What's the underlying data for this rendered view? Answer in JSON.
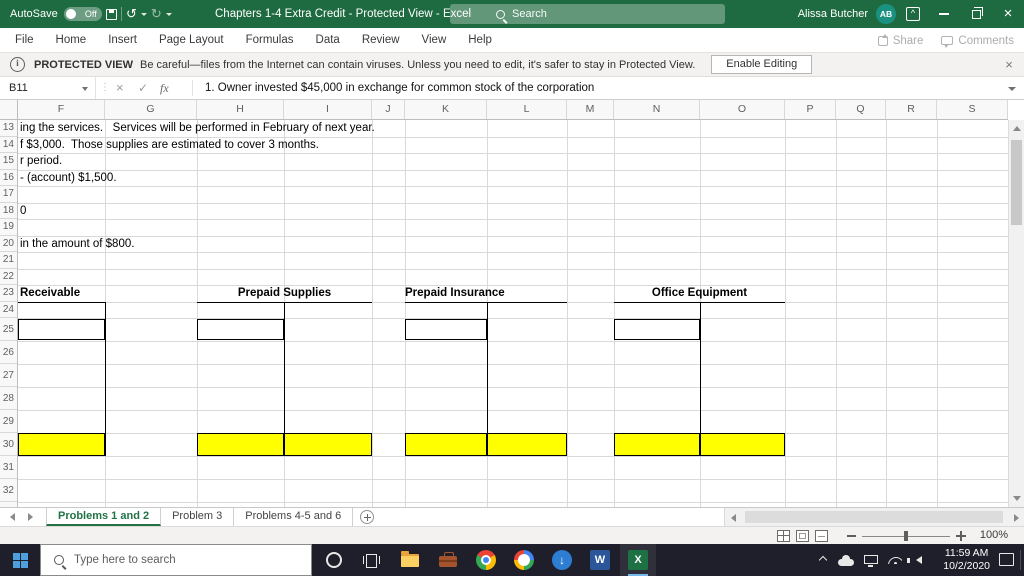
{
  "title_bar": {
    "autosave_label": "AutoSave",
    "autosave_state": "Off",
    "document_title": "Chapters 1-4 Extra Credit - Protected View - Excel",
    "search_placeholder": "Search",
    "user_name": "Alissa Butcher",
    "user_initials": "AB"
  },
  "menu_bar": {
    "tabs": [
      "File",
      "Home",
      "Insert",
      "Page Layout",
      "Formulas",
      "Data",
      "Review",
      "View",
      "Help"
    ],
    "share_label": "Share",
    "comments_label": "Comments"
  },
  "protected_view": {
    "badge": "PROTECTED VIEW",
    "message": "Be careful—files from the Internet can contain viruses. Unless you need to edit, it's safer to stay in Protected View.",
    "enable_button_label": "Enable Editing"
  },
  "formula_bar": {
    "cell_reference": "B11",
    "function_label": "fx",
    "formula_text": "1. Owner invested $45,000 in exchange for common stock of the corporation"
  },
  "grid": {
    "visible_columns": [
      "F",
      "G",
      "H",
      "I",
      "J",
      "K",
      "L",
      "M",
      "N",
      "O",
      "P",
      "Q",
      "R",
      "S"
    ],
    "first_row": 13,
    "last_row": 32,
    "cell_texts": [
      {
        "row": 13,
        "text": "ing the services.   Services will be performed in February of next year."
      },
      {
        "row": 14,
        "text": "f $3,000.  Those supplies are estimated to cover 3 months."
      },
      {
        "row": 15,
        "text": "r period."
      },
      {
        "row": 16,
        "text": "- (account) $1,500."
      },
      {
        "row": 18,
        "text": "0"
      },
      {
        "row": 20,
        "text": "in the amount of $800."
      }
    ],
    "t_accounts": [
      {
        "name": "Receivable"
      },
      {
        "name": "Prepaid Supplies"
      },
      {
        "name": "Prepaid Insurance"
      },
      {
        "name": "Office Equipment"
      }
    ],
    "highlight_color": "#ffff00"
  },
  "sheet_tabs": {
    "tabs": [
      {
        "label": "Problems 1 and 2",
        "active": true
      },
      {
        "label": "Problem 3",
        "active": false
      },
      {
        "label": "Problems 4-5 and 6",
        "active": false
      }
    ]
  },
  "status_bar": {
    "zoom_level": "100%"
  },
  "taskbar": {
    "search_placeholder": "Type here to search",
    "word_letter": "W",
    "excel_letter": "X",
    "clock_time": "11:59 AM",
    "clock_date": "10/2/2020"
  }
}
